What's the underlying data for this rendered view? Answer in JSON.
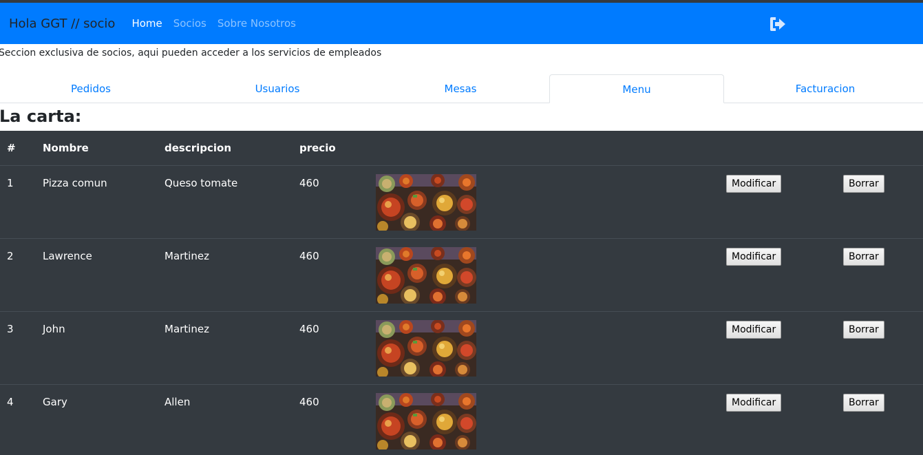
{
  "navbar": {
    "brand": "Hola GGT // socio",
    "links": [
      {
        "label": "Home",
        "active": true
      },
      {
        "label": "Socios",
        "active": false
      },
      {
        "label": "Sobre Nosotros",
        "active": false
      }
    ],
    "logout_icon": "sign-out-icon"
  },
  "intro_text": "Seccion exclusiva de socios, aqui pueden acceder a los servicios de empleados",
  "tabs": [
    {
      "label": "Pedidos",
      "active": false
    },
    {
      "label": "Usuarios",
      "active": false
    },
    {
      "label": "Mesas",
      "active": false
    },
    {
      "label": "Menu",
      "active": true
    },
    {
      "label": "Facturacion",
      "active": false
    }
  ],
  "heading": "La carta:",
  "table": {
    "headers": {
      "num": "#",
      "nombre": "Nombre",
      "descripcion": "descripcion",
      "precio": "precio"
    },
    "rows": [
      {
        "num": "1",
        "nombre": "Pizza comun",
        "descripcion": "Queso tomate",
        "precio": "460",
        "image": "food-dishes-photo"
      },
      {
        "num": "2",
        "nombre": "Lawrence",
        "descripcion": "Martinez",
        "precio": "460",
        "image": "food-dishes-photo"
      },
      {
        "num": "3",
        "nombre": "John",
        "descripcion": "Martinez",
        "precio": "460",
        "image": "food-dishes-photo"
      },
      {
        "num": "4",
        "nombre": "Gary",
        "descripcion": "Allen",
        "precio": "460",
        "image": "food-dishes-photo"
      }
    ],
    "modify_label": "Modificar",
    "delete_label": "Borrar"
  },
  "colors": {
    "navbar_bg": "#007bff",
    "table_bg": "#343a40",
    "link": "#007bff"
  }
}
